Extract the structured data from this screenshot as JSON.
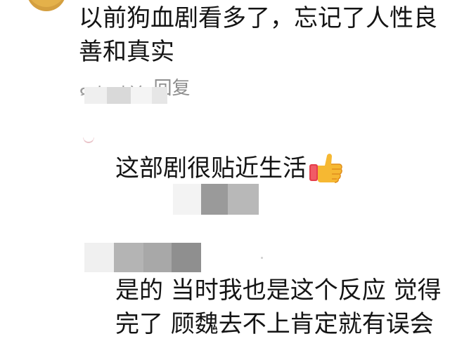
{
  "comments": [
    {
      "text_lines": [
        "以前狗血剧看多了，忘记了人性良",
        "善和真实"
      ],
      "time": "8小时前",
      "reply_label": "回复"
    },
    {
      "text": "这部剧很贴近生活",
      "emoji": "thumbs-up-icon"
    },
    {
      "text_lines": [
        "是的 当时我也是这个反应 觉得",
        "完了 顾魏去不上肯定就有误会"
      ]
    }
  ],
  "colors": {
    "text": "#141414",
    "meta": "#9b9b9b",
    "avatar": "#e4b14a",
    "thumb": "#f6b832",
    "cuff": "#e53f4d"
  }
}
